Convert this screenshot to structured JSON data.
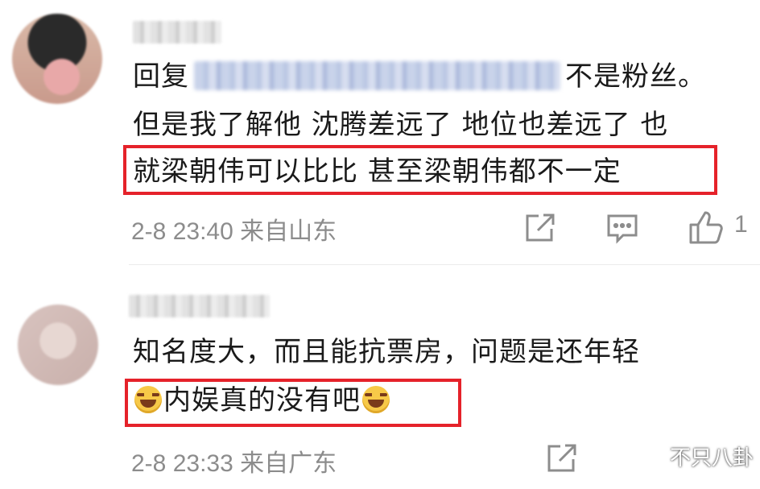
{
  "comments": [
    {
      "reply_prefix": "回复",
      "line1_suffix": "不是粉丝。",
      "line2": "但是我了解他 沈腾差远了 地位也差远了 也",
      "line3": "就梁朝伟可以比比 甚至梁朝伟都不一定",
      "timestamp": "2-8 23:40",
      "location": "来自山东",
      "like_count": "1",
      "icons": [
        "share-icon",
        "comment-icon",
        "like-icon"
      ]
    },
    {
      "line1": "知名度大，而且能抗票房，问题是还年轻",
      "line2_text": "内娱真的没有吧",
      "line2_emoji": "laughing-tears-emoji",
      "timestamp": "2-8 23:33",
      "location": "来自广东",
      "icons": [
        "share-icon"
      ]
    }
  ],
  "highlight_color": "#e5222a",
  "watermark": {
    "text": "不只八卦",
    "icon": "wechat-icon"
  }
}
